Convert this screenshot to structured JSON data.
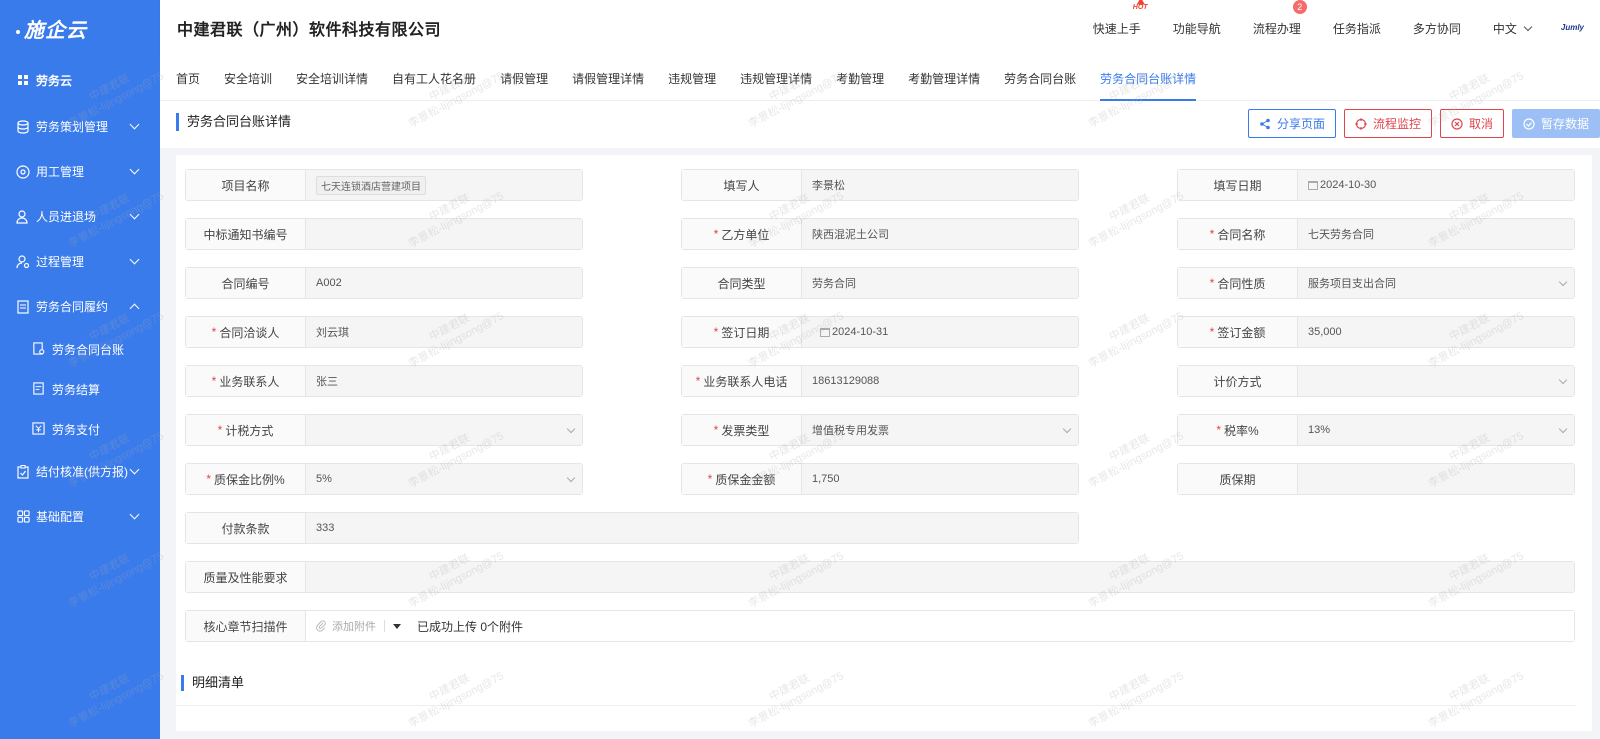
{
  "app": {
    "logo_text": "施企云",
    "company": "中建君联（广州）软件科技有限公司",
    "brand": "Jumly"
  },
  "sidebar": {
    "items": [
      {
        "label": "劳务云",
        "icon": "grid-icon"
      },
      {
        "label": "劳务策划管理",
        "icon": "database-icon"
      },
      {
        "label": "用工管理",
        "icon": "settings-circle-icon"
      },
      {
        "label": "人员进退场",
        "icon": "user-icon"
      },
      {
        "label": "过程管理",
        "icon": "user-gear-icon"
      },
      {
        "label": "劳务合同履约",
        "icon": "document-icon"
      },
      {
        "label": "结付核准(供方报)",
        "icon": "clipboard-check-icon"
      },
      {
        "label": "基础配置",
        "icon": "apps-icon"
      }
    ],
    "subitems": [
      {
        "label": "劳务合同台账"
      },
      {
        "label": "劳务结算"
      },
      {
        "label": "劳务支付"
      }
    ]
  },
  "header": {
    "nav": [
      {
        "label": "快速上手",
        "hot": "HOT"
      },
      {
        "label": "功能导航"
      },
      {
        "label": "流程办理",
        "badge": "2"
      },
      {
        "label": "任务指派"
      },
      {
        "label": "多方协同"
      }
    ],
    "language": "中文"
  },
  "tabs": [
    "首页",
    "安全培训",
    "安全培训详情",
    "自有工人花名册",
    "请假管理",
    "请假管理详情",
    "违规管理",
    "违规管理详情",
    "考勤管理",
    "考勤管理详情",
    "劳务合同台账",
    "劳务合同台账详情"
  ],
  "page": {
    "title": "劳务合同台账详情",
    "buttons": {
      "share": "分享页面",
      "monitor": "流程监控",
      "cancel": "取消",
      "save": "暂存数据"
    }
  },
  "form": {
    "fields": [
      {
        "label": "项目名称",
        "value": "七天连锁酒店营建项目",
        "required": false,
        "tag": true
      },
      {
        "label": "填写人",
        "value": "李景松",
        "required": false
      },
      {
        "label": "填写日期",
        "value": "2024-10-30",
        "required": false,
        "date": true
      },
      {
        "label": "中标通知书编号",
        "value": "",
        "required": false
      },
      {
        "label": "乙方单位",
        "value": "陕西混泥土公司",
        "required": true
      },
      {
        "label": "合同名称",
        "value": "七天劳务合同",
        "required": true
      },
      {
        "label": "合同编号",
        "value": "A002",
        "required": false
      },
      {
        "label": "合同类型",
        "value": "劳务合同",
        "required": false
      },
      {
        "label": "合同性质",
        "value": "服务项目支出合同",
        "required": true,
        "select": true
      },
      {
        "label": "合同洽谈人",
        "value": "刘云琪",
        "required": true
      },
      {
        "label": "签订日期",
        "value": "2024-10-31",
        "required": true,
        "date": true
      },
      {
        "label": "签订金额",
        "value": "35,000",
        "required": true
      },
      {
        "label": "业务联系人",
        "value": "张三",
        "required": true
      },
      {
        "label": "业务联系人电话",
        "value": "18613129088",
        "required": true
      },
      {
        "label": "计价方式",
        "value": "",
        "required": false,
        "select": true
      },
      {
        "label": "计税方式",
        "value": "",
        "required": true,
        "select": true
      },
      {
        "label": "发票类型",
        "value": "增值税专用发票",
        "required": true,
        "select": true
      },
      {
        "label": "税率%",
        "value": "13%",
        "required": true,
        "select": true
      },
      {
        "label": "质保金比例%",
        "value": "5%",
        "required": true,
        "select": true
      },
      {
        "label": "质保金金额",
        "value": "1,750",
        "required": true
      },
      {
        "label": "质保期",
        "value": "",
        "required": false
      },
      {
        "label": "付款条款",
        "value": "333",
        "required": false
      },
      {
        "label": "质量及性能要求",
        "value": "",
        "required": false
      }
    ],
    "attachment": {
      "label": "核心章节扫描件",
      "add_label": "添加附件",
      "status": "已成功上传 0个附件"
    }
  },
  "detail_section": {
    "title": "明细清单"
  },
  "watermark": {
    "line1": "中建君联",
    "line2": "李景松-lijingsong@75"
  },
  "colors": {
    "primary": "#3a7bec",
    "danger": "#e0454d",
    "sidebar": "#3a7bec"
  }
}
